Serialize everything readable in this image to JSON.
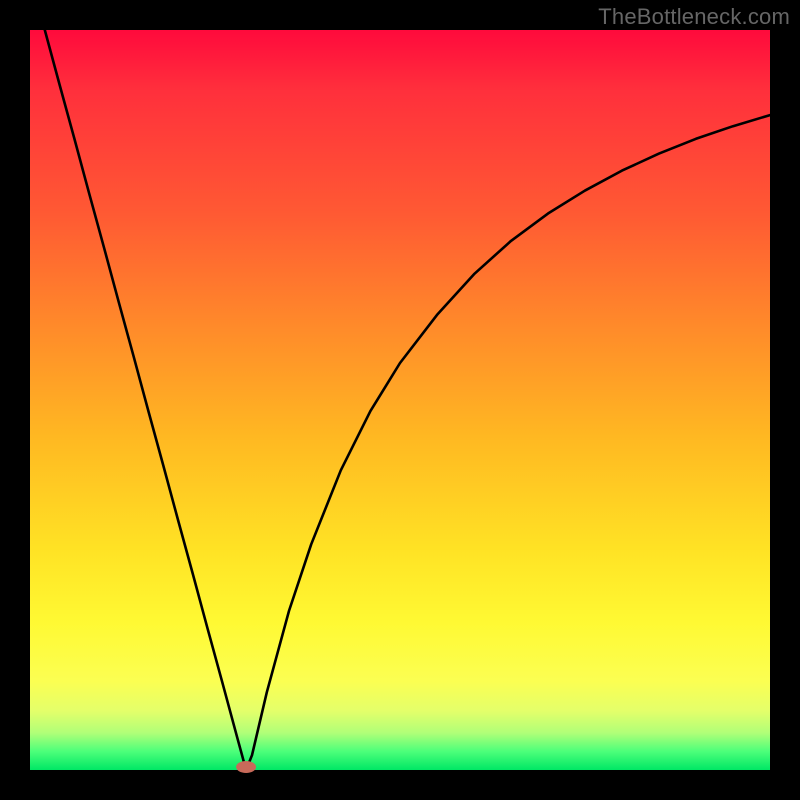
{
  "watermark": "TheBottleneck.com",
  "chart_data": {
    "type": "line",
    "title": "",
    "xlabel": "",
    "ylabel": "",
    "xlim": [
      0,
      100
    ],
    "ylim": [
      0,
      100
    ],
    "grid": false,
    "legend": false,
    "series": [
      {
        "name": "bottleneck-curve",
        "x": [
          2,
          4,
          6,
          8,
          10,
          12,
          14,
          16,
          18,
          20,
          22,
          24,
          26,
          28,
          29.2,
          30,
          32,
          35,
          38,
          42,
          46,
          50,
          55,
          60,
          65,
          70,
          75,
          80,
          85,
          90,
          95,
          100
        ],
        "y": [
          100,
          92.6,
          85.3,
          77.9,
          70.6,
          63.2,
          55.9,
          48.5,
          41.2,
          33.8,
          26.5,
          19.1,
          11.8,
          4.4,
          0,
          2.0,
          10.5,
          21.5,
          30.5,
          40.5,
          48.5,
          55.0,
          61.5,
          67.0,
          71.5,
          75.2,
          78.3,
          81.0,
          83.3,
          85.3,
          87.0,
          88.5
        ]
      }
    ],
    "marker": {
      "name": "optimal-point",
      "x": 29.2,
      "y": 0,
      "color": "#c86a5a",
      "shape": "pill"
    },
    "background_gradient": {
      "top_color": "#ff0a3c",
      "bottom_color": "#00e765",
      "stops": [
        "red",
        "orange",
        "yellow",
        "green"
      ]
    }
  }
}
